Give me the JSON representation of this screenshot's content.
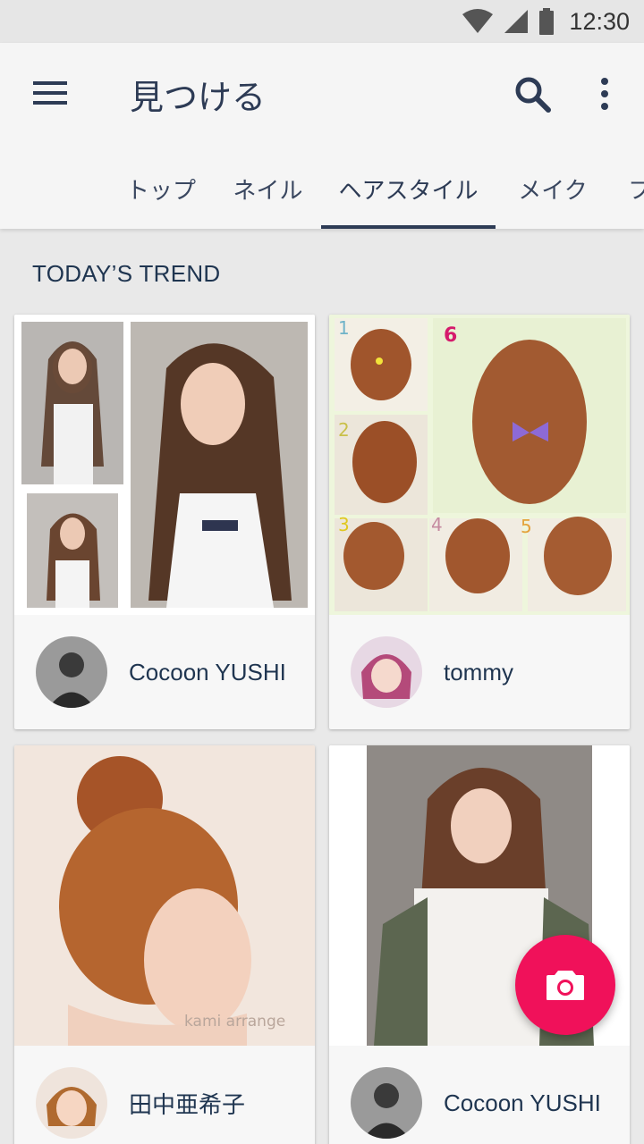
{
  "status_bar": {
    "time": "12:30"
  },
  "app_bar": {
    "title": "見つける",
    "tabs": [
      {
        "label": "トップ"
      },
      {
        "label": "ネイル"
      },
      {
        "label": "ヘアスタイル",
        "active": true
      },
      {
        "label": "メイク"
      },
      {
        "label": "フ"
      }
    ]
  },
  "section": {
    "title": "TODAY’S TREND"
  },
  "cards": [
    {
      "author": "Cocoon YUSHI"
    },
    {
      "author": "tommy",
      "image_overlay_labels": [
        "1",
        "2",
        "3",
        "4",
        "5",
        "6"
      ]
    },
    {
      "author": "田中亜希子",
      "image_caption": "kami arrange"
    },
    {
      "author": "Cocoon YUSHI"
    }
  ],
  "colors": {
    "primary": "#2d3b55",
    "fab": "#f0115a",
    "background": "#e9e9e9"
  },
  "icons": {
    "menu": "menu-icon",
    "search": "search-icon",
    "more": "more-vert-icon",
    "fab": "camera-icon"
  }
}
